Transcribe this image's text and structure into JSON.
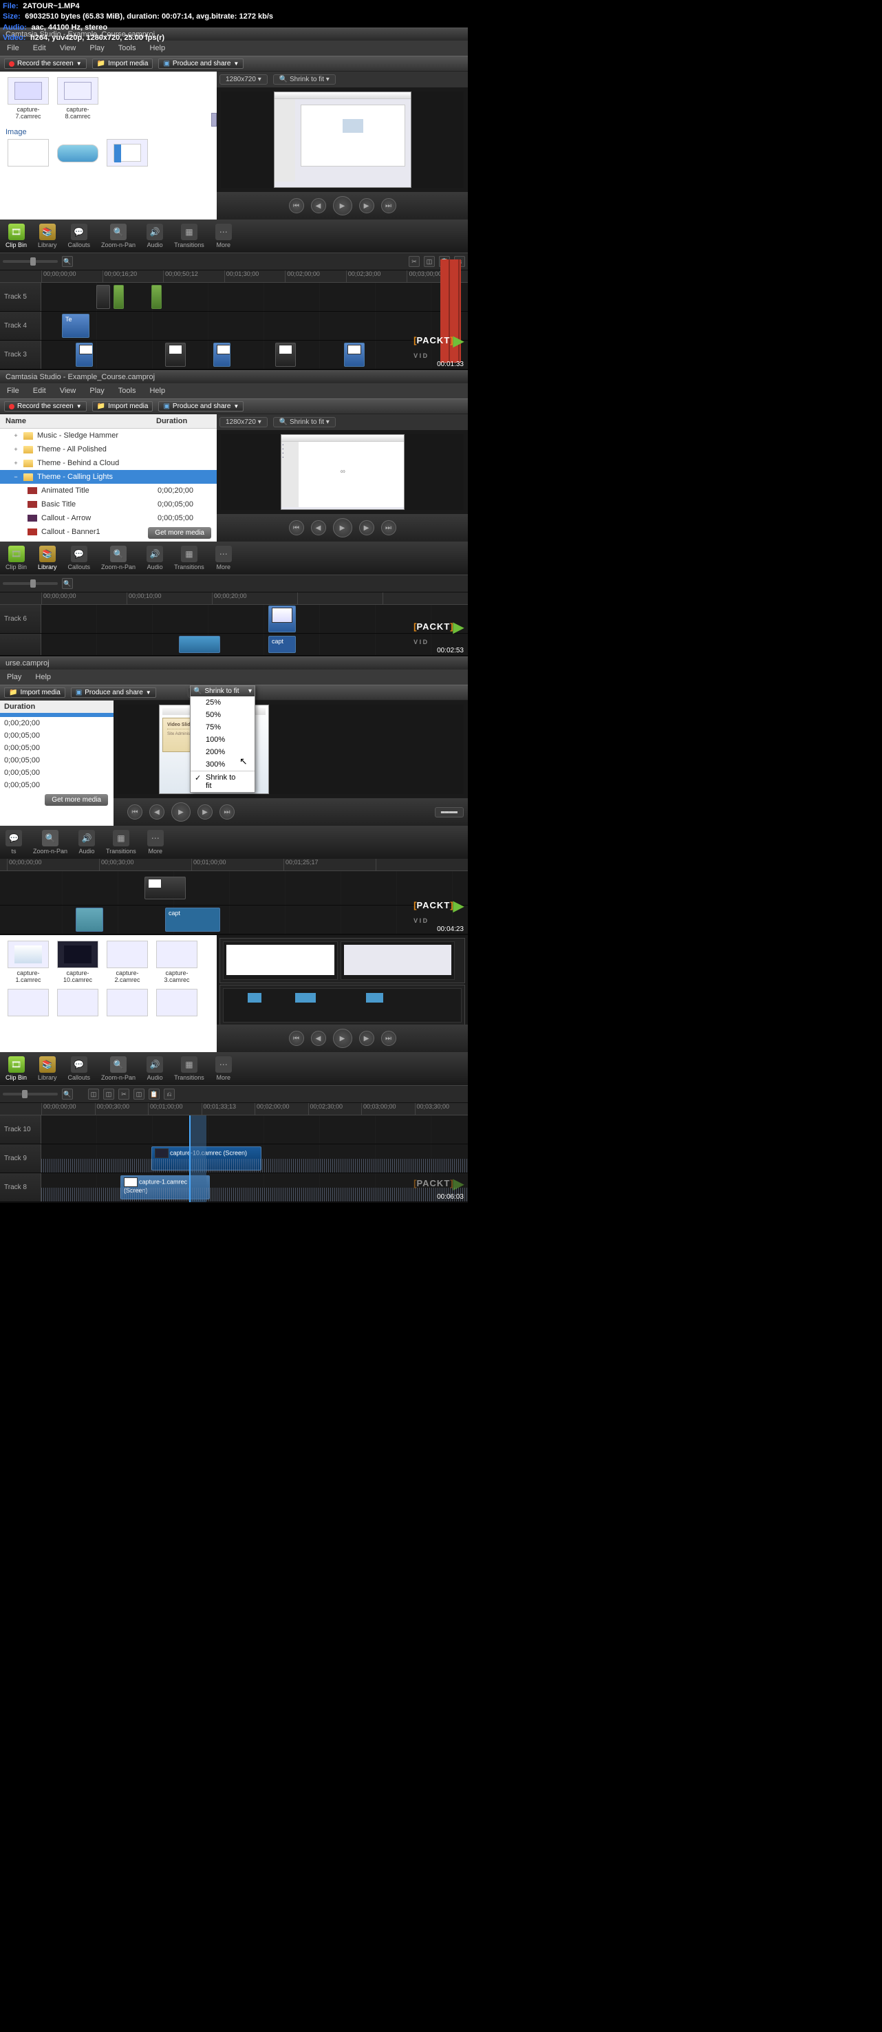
{
  "overlay": {
    "file_label": "File:",
    "file": "2ATOUR~1.MP4",
    "size_label": "Size:",
    "size": "69032510 bytes (65.83 MiB), duration: 00:07:14, avg.bitrate: 1272 kb/s",
    "audio_label": "Audio:",
    "audio": "aac, 44100 Hz, stereo",
    "video_label": "Video:",
    "video": "h264, yuv420p, 1280x720, 25.00 fps(r)"
  },
  "app_title": "Camtasia Studio - Example_Course.camproj",
  "menu": [
    "File",
    "Edit",
    "View",
    "Play",
    "Tools",
    "Help"
  ],
  "toolbar": {
    "record": "Record the screen",
    "import": "Import media",
    "produce": "Produce and share"
  },
  "zoom_pills": {
    "dim": "1280x720",
    "fit": "Shrink to fit"
  },
  "tool_tabs": [
    "Clip Bin",
    "Library",
    "Callouts",
    "Zoom-n-Pan",
    "Audio",
    "Transitions",
    "More"
  ],
  "packt": {
    "brand": "PACKT",
    "sub": "V I D"
  },
  "sec1": {
    "thumbs": [
      "capture-7.camrec",
      "capture-8.camrec"
    ],
    "image_label": "Image",
    "ruler": [
      "00;00;00;00",
      "00;00;16;20",
      "00;00;50;12",
      "00;01;30;00",
      "00;02;00;00",
      "00;02;30;00",
      "00;03;00;00"
    ],
    "tracks": [
      "Track 5",
      "Track 4",
      "Track 3"
    ],
    "clip4": "Te",
    "timestamp": "00:01:33"
  },
  "sec2": {
    "col_name": "Name",
    "col_dur": "Duration",
    "items": [
      {
        "name": "Music - Sledge Hammer",
        "type": "folder",
        "exp": "+"
      },
      {
        "name": "Theme - All Polished",
        "type": "folder",
        "exp": "+"
      },
      {
        "name": "Theme - Behind a Cloud",
        "type": "folder",
        "exp": "+"
      },
      {
        "name": "Theme - Calling Lights",
        "type": "folder",
        "exp": "−",
        "selected": true
      },
      {
        "name": "Animated Title",
        "type": "item",
        "dur": "0;00;20;00",
        "color": "#a03030"
      },
      {
        "name": "Basic Title",
        "type": "item",
        "dur": "0;00;05;00",
        "color": "#a03030"
      },
      {
        "name": "Callout - Arrow",
        "type": "item",
        "dur": "0;00;05;00",
        "color": "#552a55"
      },
      {
        "name": "Callout - Banner1",
        "type": "item",
        "dur": "",
        "color": "#b0302a"
      }
    ],
    "get_more": "Get more media",
    "ruler": [
      "00;00;00;00",
      "00;00;10;00",
      "00;00;20;00"
    ],
    "tracks": [
      "Track 6"
    ],
    "clip": "capt",
    "timestamp": "00:02:53"
  },
  "sec3": {
    "title_fragment": "urse.camproj",
    "menu_short": [
      "Play",
      "Help"
    ],
    "durations_hdr": "Duration",
    "durations": [
      "0;00;20;00",
      "0;00;05;00",
      "0;00;05;00",
      "0;00;05;00",
      "0;00;05;00",
      "0;00;05;00"
    ],
    "get_more": "Get more media",
    "zoom_options": [
      "25%",
      "50%",
      "75%",
      "100%",
      "200%",
      "300%",
      "Shrink to fit"
    ],
    "zoom_selected": "Shrink to fit",
    "video_slide_title": "Video Slide",
    "video_slide_sub": "Site Administration Settings",
    "tool_tabs_short": [
      "ts",
      "Zoom-n-Pan",
      "Audio",
      "Transitions",
      "More"
    ],
    "ruler": [
      "00;00;00;00",
      "00;00;30;00",
      "00;01;00;00",
      "00;01;25;17"
    ],
    "clip": "capt",
    "timestamp": "00:04:23"
  },
  "sec4": {
    "thumbs": [
      "capture-1.camrec",
      "capture-10.camrec",
      "capture-2.camrec",
      "capture-3.camrec"
    ],
    "ruler": [
      "00;00;00;00",
      "00;00;30;00",
      "00;01;00;00",
      "00;01;33;13",
      "00;02;00;00",
      "00;02;30;00",
      "00;03;00;00",
      "00;03;30;00"
    ],
    "tracks": [
      "Track 10",
      "Track 9",
      "Track 8"
    ],
    "clip9": "capture-10.camrec (Screen)",
    "clip8": "capture-1.camrec (Screen)",
    "timestamp": "00:06:03"
  }
}
